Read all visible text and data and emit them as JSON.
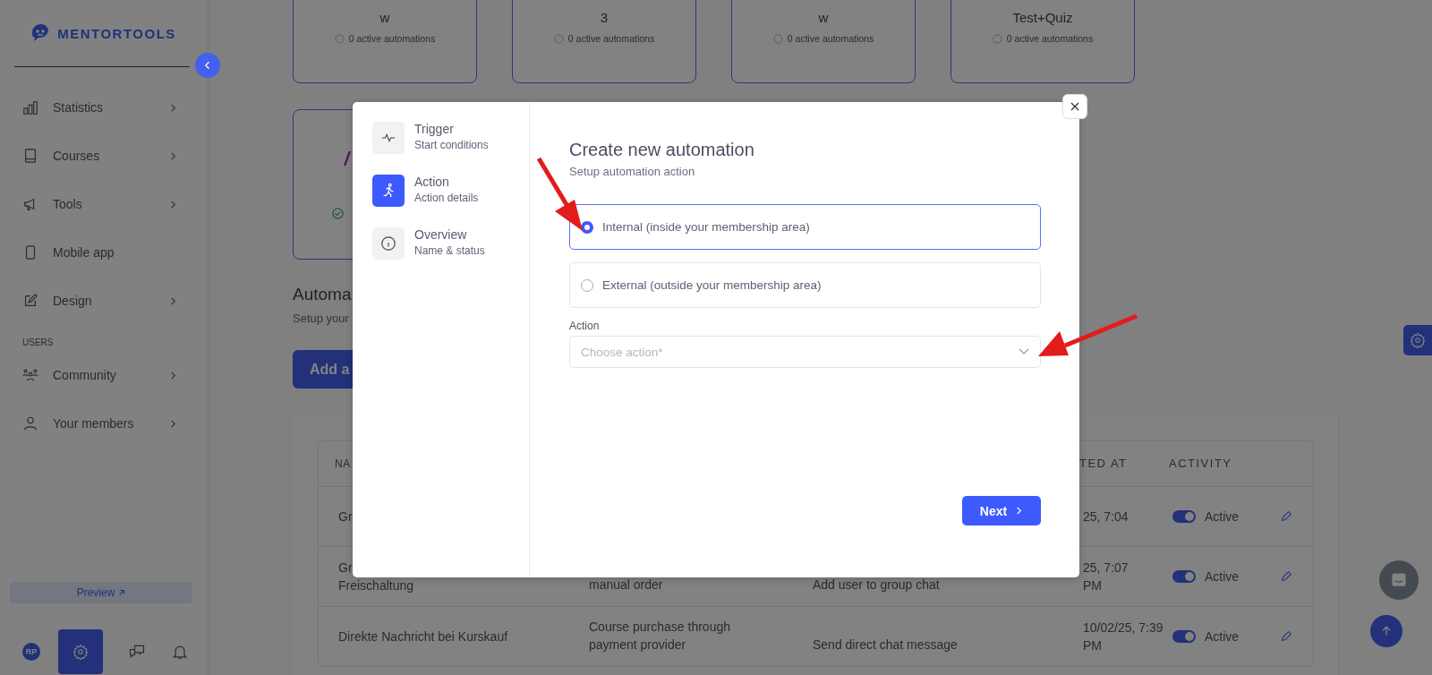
{
  "sidebar": {
    "logo": "MENTORTOOLS",
    "items": [
      {
        "label": "Statistics",
        "expandable": true
      },
      {
        "label": "Courses",
        "expandable": true
      },
      {
        "label": "Tools",
        "expandable": true
      },
      {
        "label": "Mobile app",
        "expandable": false
      },
      {
        "label": "Design",
        "expandable": true
      }
    ],
    "section": {
      "label": "USERS",
      "items": [
        {
          "label": "Community",
          "expandable": true
        },
        {
          "label": "Your members",
          "expandable": true
        }
      ]
    },
    "preview_button": "Preview",
    "avatar_initials": "RP"
  },
  "cards": [
    {
      "title": "w",
      "status": "0 active automations"
    },
    {
      "title": "3",
      "status": "0 active automations"
    },
    {
      "title": "w",
      "status": "0 active automations"
    },
    {
      "title": "Test+Quiz",
      "status": "0 active automations"
    }
  ],
  "heading": "Automa",
  "subheading": "Setup your",
  "add_button": "Add a",
  "table": {
    "header": {
      "column_1": "NA",
      "column_4": "TED AT",
      "column_5": "ACTIVITY"
    },
    "rows": [
      {
        "name": [
          "Gr"
        ],
        "created": [
          "25, 7:04"
        ],
        "active": true,
        "status": "Active"
      },
      {
        "name": [
          "Gr",
          "Freischaltung"
        ],
        "trigger": [
          "manual order"
        ],
        "action": [
          "Add user to group chat"
        ],
        "created": [
          "25, 7:07",
          "PM"
        ],
        "active": true,
        "status": "Active"
      },
      {
        "name": [
          "Direkte Nachricht bei Kurskauf"
        ],
        "trigger": [
          "Course purchase through",
          "payment provider"
        ],
        "action": [
          "Send direct chat message"
        ],
        "created": [
          "10/02/25, 7:39",
          "PM"
        ],
        "active": true,
        "status": "Active"
      }
    ]
  },
  "modal": {
    "steps": [
      {
        "title": "Trigger",
        "subtitle": "Start conditions",
        "selected": false
      },
      {
        "title": "Action",
        "subtitle": "Action details",
        "selected": true
      },
      {
        "title": "Overview",
        "subtitle": "Name & status",
        "selected": false
      }
    ],
    "title": "Create new automation",
    "subtitle": "Setup automation action",
    "options": [
      {
        "label": "Internal (inside your membership area)",
        "selected": true
      },
      {
        "label": "External (outside your membership area)",
        "selected": false
      }
    ],
    "field": {
      "label": "Action",
      "placeholder": "Choose action*"
    },
    "next_button": "Next"
  }
}
